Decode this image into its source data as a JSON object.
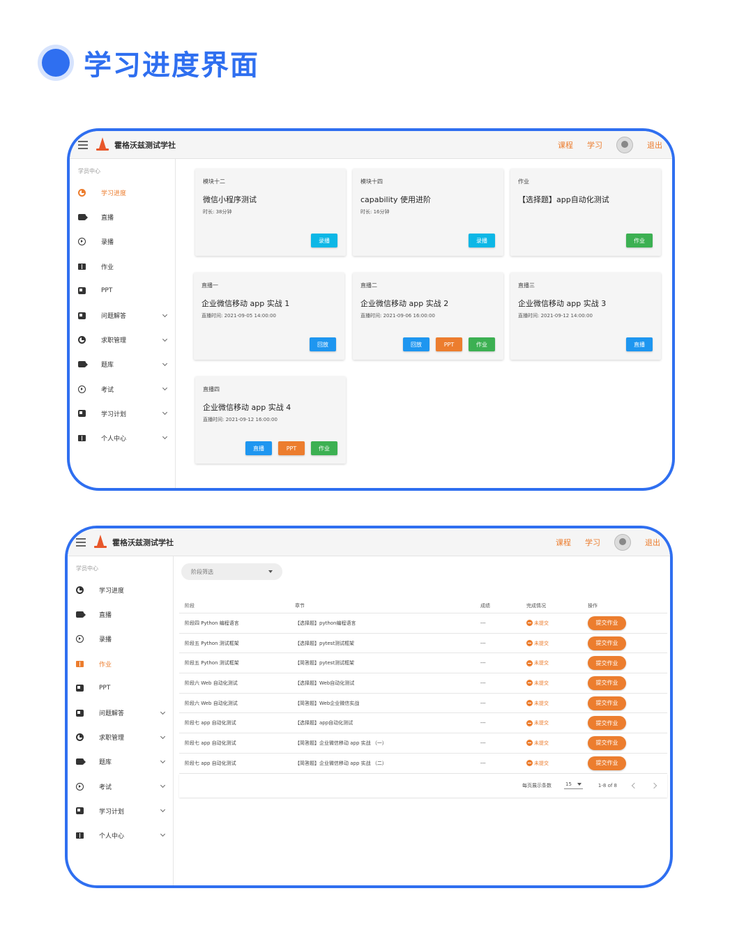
{
  "heading": "学习进度界面",
  "topbar": {
    "brand": "霍格沃兹测试学社",
    "nav": [
      "课程",
      "学习",
      "退出"
    ]
  },
  "sidebar": {
    "title": "学员中心",
    "items": [
      {
        "label": "学习进度",
        "icon": "pie-icon",
        "expand": false
      },
      {
        "label": "直播",
        "icon": "camera-icon",
        "expand": false
      },
      {
        "label": "录播",
        "icon": "play-icon",
        "expand": false
      },
      {
        "label": "作业",
        "icon": "book-icon",
        "expand": false
      },
      {
        "label": "PPT",
        "icon": "ppt-icon",
        "expand": false
      },
      {
        "label": "问题解答",
        "icon": "ppt-icon",
        "expand": true
      },
      {
        "label": "求职管理",
        "icon": "pie-icon",
        "expand": true
      },
      {
        "label": "题库",
        "icon": "camera-icon",
        "expand": true
      },
      {
        "label": "考试",
        "icon": "play-icon",
        "expand": true
      },
      {
        "label": "学习计划",
        "icon": "ppt-icon",
        "expand": true
      },
      {
        "label": "个人中心",
        "icon": "book-icon",
        "expand": true
      }
    ]
  },
  "screen1": {
    "active_item": 0,
    "cards": [
      {
        "tag": "模块十二",
        "title": "微信小程序测试",
        "meta": "时长: 38分钟",
        "buttons": [
          {
            "label": "录播",
            "color": "#0cb7e6"
          }
        ]
      },
      {
        "tag": "模块十四",
        "title": "capability 使用进阶",
        "meta": "时长: 16分钟",
        "buttons": [
          {
            "label": "录播",
            "color": "#0cb7e6"
          }
        ]
      },
      {
        "tag": "作业",
        "title": "【选择题】app自动化测试",
        "meta": "",
        "buttons": [
          {
            "label": "作业",
            "color": "#3cb052"
          }
        ]
      },
      {
        "tag": "直播一",
        "title": "企业微信移动 app 实战 1",
        "meta": "直播时间: 2021-09-05 14:00:00",
        "buttons": [
          {
            "label": "回放",
            "color": "#1e96f0"
          }
        ]
      },
      {
        "tag": "直播二",
        "title": "企业微信移动 app 实战 2",
        "meta": "直播时间: 2021-09-06 16:00:00",
        "buttons": [
          {
            "label": "回放",
            "color": "#1e96f0"
          },
          {
            "label": "PPT",
            "color": "#ec7d2e"
          },
          {
            "label": "作业",
            "color": "#3cb052"
          }
        ]
      },
      {
        "tag": "直播三",
        "title": "企业微信移动 app 实战 3",
        "meta": "直播时间: 2021-09-12 14:00:00",
        "buttons": [
          {
            "label": "直播",
            "color": "#1e96f0"
          }
        ]
      },
      {
        "tag": "直播四",
        "title": "企业微信移动 app 实战 4",
        "meta": "直播时间: 2021-09-12 16:00:00",
        "buttons": [
          {
            "label": "直播",
            "color": "#1e96f0"
          },
          {
            "label": "PPT",
            "color": "#ec7d2e"
          },
          {
            "label": "作业",
            "color": "#3cb052"
          }
        ]
      }
    ]
  },
  "screen2": {
    "active_item": 3,
    "filter_placeholder": "阶段筛选",
    "columns": [
      "阶段",
      "章节",
      "成绩",
      "完成情况",
      "操作"
    ],
    "rows": [
      {
        "stage": "阶段四 Python 编程语言",
        "chapter": "【选择题】python编程语言",
        "score": "---",
        "status": "未提交",
        "action": "提交作业"
      },
      {
        "stage": "阶段五 Python 测试框架",
        "chapter": "【选择题】pytest测试框架",
        "score": "---",
        "status": "未提交",
        "action": "提交作业"
      },
      {
        "stage": "阶段五 Python 测试框架",
        "chapter": "【简答题】pytest测试框架",
        "score": "---",
        "status": "未提交",
        "action": "提交作业"
      },
      {
        "stage": "阶段六 Web 自动化测试",
        "chapter": "【选择题】Web自动化测试",
        "score": "---",
        "status": "未提交",
        "action": "提交作业"
      },
      {
        "stage": "阶段六 Web 自动化测试",
        "chapter": "【简答题】Web企业微信实战",
        "score": "---",
        "status": "未提交",
        "action": "提交作业"
      },
      {
        "stage": "阶段七 app 自动化测试",
        "chapter": "【选择题】app自动化测试",
        "score": "---",
        "status": "未提交",
        "action": "提交作业"
      },
      {
        "stage": "阶段七 app 自动化测试",
        "chapter": "【简答题】企业微信移动 app 实战 （一）",
        "score": "---",
        "status": "未提交",
        "action": "提交作业"
      },
      {
        "stage": "阶段七 app 自动化测试",
        "chapter": "【简答题】企业微信移动 app 实战 （二）",
        "score": "---",
        "status": "未提交",
        "action": "提交作业"
      }
    ],
    "footer": {
      "rows_per_page_label": "每页展示条数",
      "rows_per_page": "15",
      "range": "1-8 of 8"
    }
  }
}
